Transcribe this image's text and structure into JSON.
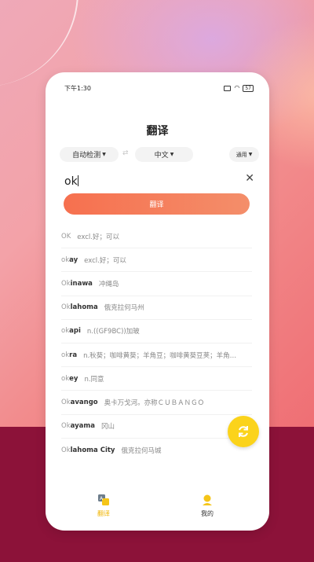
{
  "status": {
    "time": "下午1:30",
    "battery": "57"
  },
  "header": {
    "title": "翻译"
  },
  "langs": {
    "source": "自动检测",
    "swap": "⇄",
    "target": "中文",
    "mode": "通用"
  },
  "input": {
    "value": "ok"
  },
  "translate_button": "翻译",
  "suggestions": [
    {
      "prefix": "OK",
      "rest": "",
      "meaning": "excl.好；可以"
    },
    {
      "prefix": "ok",
      "rest": "ay",
      "meaning": "excl.好；可以"
    },
    {
      "prefix": "Ok",
      "rest": "inawa",
      "meaning": "冲绳岛"
    },
    {
      "prefix": "Ok",
      "rest": "lahoma",
      "meaning": "俄克拉何马州"
    },
    {
      "prefix": "ok",
      "rest": "api",
      "meaning": "n.((GF9BC))加玻"
    },
    {
      "prefix": "ok",
      "rest": "ra",
      "meaning": "n.秋葵；咖啡黄葵；羊角豆；咖啡黄葵豆荚；羊角…"
    },
    {
      "prefix": "ok",
      "rest": "ey",
      "meaning": "n.同意"
    },
    {
      "prefix": "Ok",
      "rest": "avango",
      "meaning": "奥卡万戈河。亦称ＣＵＢＡＮＧＯ"
    },
    {
      "prefix": "Ok",
      "rest": "ayama",
      "meaning": "冈山"
    },
    {
      "prefix": "Ok",
      "rest": "lahoma City",
      "meaning": "俄克拉何马城"
    }
  ],
  "tabs": {
    "translate": "翻译",
    "mine": "我的"
  },
  "colors": {
    "accent": "#f6704f",
    "fab": "#fbd31b",
    "tab_active": "#f0b400",
    "backdrop": "#8c1239"
  }
}
